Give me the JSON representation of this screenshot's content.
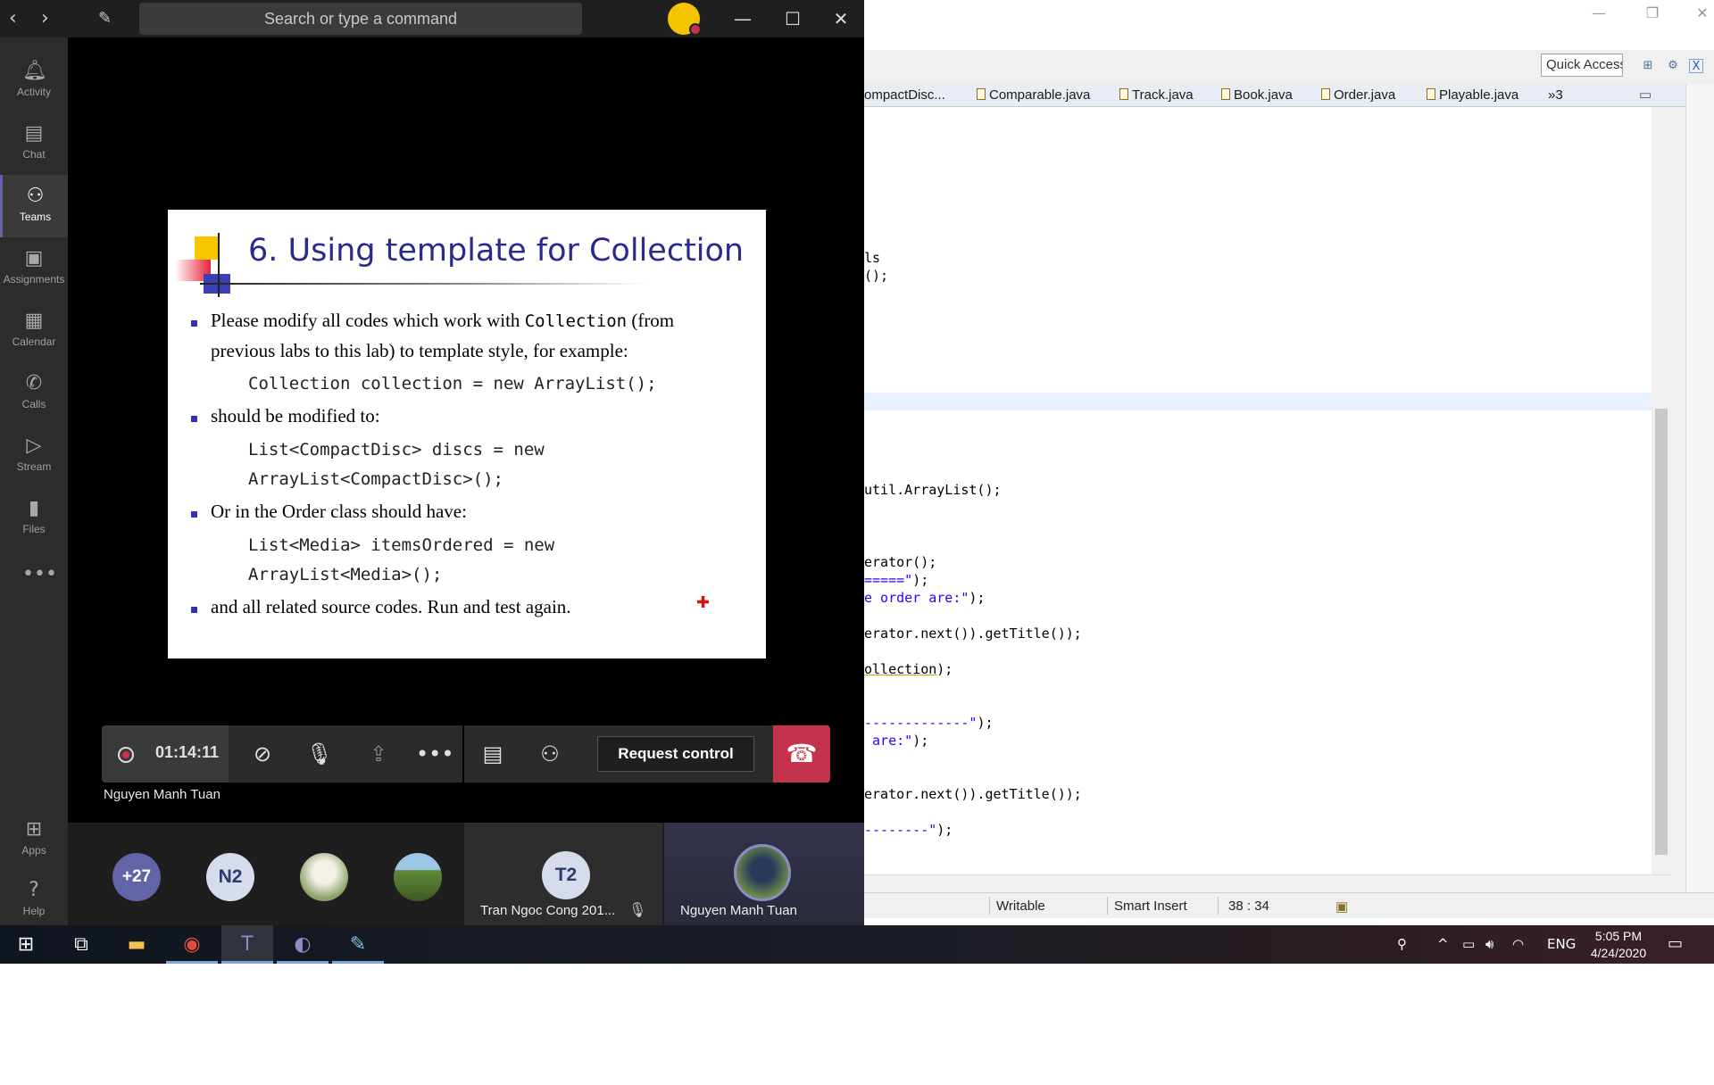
{
  "teams": {
    "search_placeholder": "Search or type a command",
    "rail": [
      {
        "label": "Activity",
        "icon": "bell-icon"
      },
      {
        "label": "Chat",
        "icon": "chat-icon"
      },
      {
        "label": "Teams",
        "icon": "teams-icon"
      },
      {
        "label": "Assignments",
        "icon": "assignments-icon"
      },
      {
        "label": "Calendar",
        "icon": "calendar-icon"
      },
      {
        "label": "Calls",
        "icon": "phone-icon"
      },
      {
        "label": "Stream",
        "icon": "stream-icon"
      },
      {
        "label": "Files",
        "icon": "files-icon"
      },
      {
        "label": "Apps",
        "icon": "apps-icon"
      },
      {
        "label": "Help",
        "icon": "help-icon"
      }
    ],
    "active_rail": "Teams",
    "slide": {
      "title": "6. Using template for Collection",
      "bullet1_a": "Please modify all codes which work with",
      "bullet1_code": "Collection",
      "bullet1_b": "(from",
      "bullet1_line2": "previous labs to this lab) to template style, for example:",
      "code1": "Collection collection = new ArrayList();",
      "bullet2": "should be modified to:",
      "code2_l1": "List<CompactDisc> discs = new",
      "code2_l2": "ArrayList<CompactDisc>();",
      "bullet3": "Or in the Order class should have:",
      "code3_l1": "List<Media> itemsOrdered = new",
      "code3_l2": "ArrayList<Media>();",
      "bullet4": "and all related source codes. Run and test again."
    },
    "controls": {
      "timer": "01:14:11",
      "request_control_label": "Request control"
    },
    "presenter_name": "Nguyen Manh Tuan",
    "participants": {
      "more_count": "+27",
      "initials_1": "N2",
      "tile1_initials": "T2",
      "tile1_name": "Tran Ngoc Cong 201...",
      "tile2_name": "Nguyen Manh Tuan"
    },
    "accent_color": "#6264a7",
    "hangup_color": "#c4314b"
  },
  "eclipse": {
    "quick_access": "Quick Access",
    "tabs": [
      "ompactDisc...",
      "Comparable.java",
      "Track.java",
      "Book.java",
      "Order.java",
      "Playable.java"
    ],
    "tabs_overflow": "»3",
    "code_lines": {
      "l1": "ls",
      "l2": "();",
      "l3": "util.ArrayList();",
      "l4": "erator();",
      "l5_a": "",
      "l5_str": "=====\"",
      "l5_b": ");",
      "l6_str": "e order are:\"",
      "l6_b": ");",
      "l7": "erator.next()).getTitle());",
      "l8_a": "ollection",
      "l8_b": ");",
      "l9_str": "-------------\"",
      "l9_b": ");",
      "l10_str": " are:\"",
      "l10_b": ");",
      "l11": "erator.next()).getTitle());",
      "l12_str": "--------\"",
      "l12_b": ");"
    },
    "status": {
      "writable": "Writable",
      "insert_mode": "Smart Insert",
      "position": "38 : 34"
    }
  },
  "taskbar": {
    "language": "ENG",
    "time": "5:05 PM",
    "date": "4/24/2020"
  }
}
